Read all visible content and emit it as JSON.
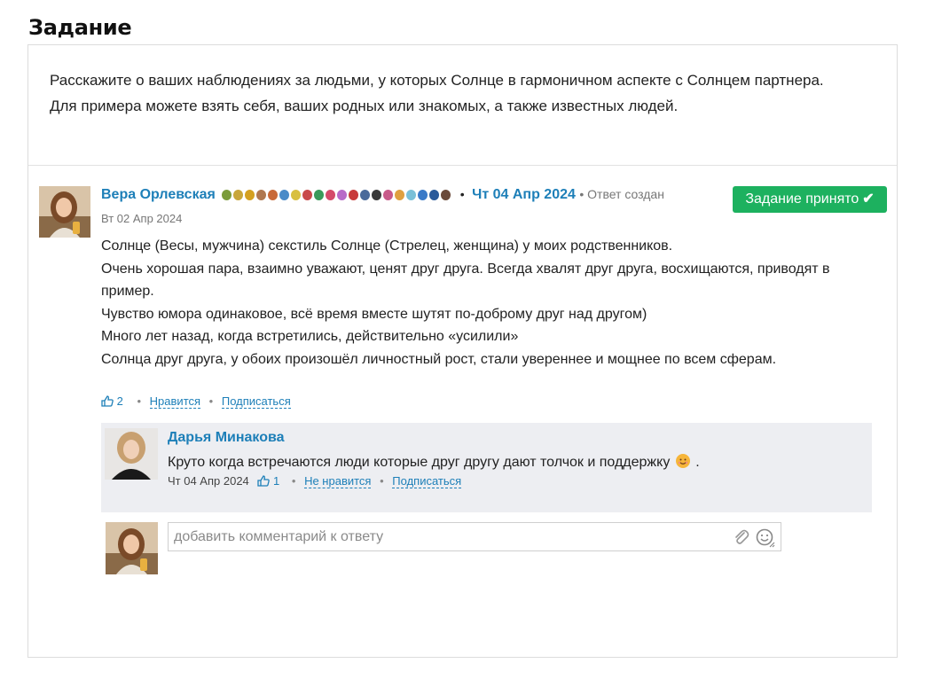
{
  "page": {
    "title": "Задание"
  },
  "task": {
    "line1": "Расскажите о ваших наблюдениях за людьми, у которых Солнце в гармоничном аспекте с Солнцем партнера.",
    "line2": "Для примера можете взять себя, ваших родных или знакомых, а также известных людей."
  },
  "answer": {
    "author": "Вера Орлевская",
    "date": "Чт 04 Апр 2024",
    "created_label": "Ответ создан",
    "created_date": "Вт 02 Апр 2024",
    "status": "Задание принято",
    "body": [
      "Солнце (Весы, мужчина) секстиль Солнце (Стрелец, женщина) у моих родственников.",
      "Очень хорошая пара, взаимно уважают, ценят друг друга. Всегда хвалят друг друга, восхищаются, приводят в пример.",
      "Чувство юмора одинаковое, всё время вместе шутят по-доброму друг над другом)",
      "Много лет назад, когда встретились, действительно «усилили»",
      "Солнца друг друга, у обоих произошёл личностный рост, стали увереннее и мощнее по всем сферам."
    ],
    "likes": "2",
    "like_label": "Нравится",
    "subscribe_label": "Подписаться",
    "badge_colors": [
      "#7a9b3a",
      "#c8a63a",
      "#d4a020",
      "#b07850",
      "#c86a3a",
      "#4a8bc8",
      "#d8c040",
      "#c84a4a",
      "#3a9a5a",
      "#d44a6a",
      "#b86ac8",
      "#c83a3a",
      "#4a6a9a",
      "#3a3a3a",
      "#c85a8a",
      "#e0a040",
      "#7ac0d8",
      "#3a7ac8",
      "#2a5a9a",
      "#6a4a3a"
    ]
  },
  "comment": {
    "author": "Дарья Минакова",
    "text": "Круто когда встречаются люди которые друг другу дают толчок и поддержку",
    "text_suffix": ".",
    "date": "Чт 04 Апр 2024",
    "likes": "1",
    "unlike_label": "Не нравится",
    "subscribe_label": "Подписаться"
  },
  "reply": {
    "placeholder": "добавить комментарий к ответу"
  }
}
